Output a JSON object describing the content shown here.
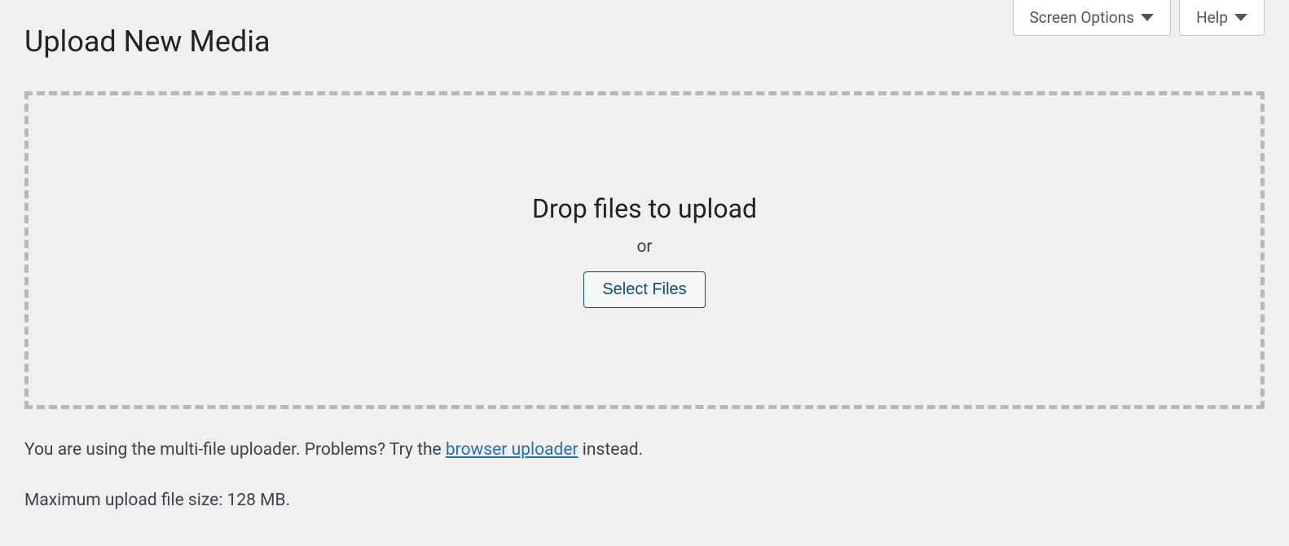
{
  "header": {
    "screen_options_label": "Screen Options",
    "help_label": "Help"
  },
  "page": {
    "title": "Upload New Media"
  },
  "dropzone": {
    "heading": "Drop files to upload",
    "or_label": "or",
    "select_button_label": "Select Files"
  },
  "info": {
    "prefix": "You are using the multi-file uploader. Problems? Try the ",
    "link_text": "browser uploader",
    "suffix": " instead.",
    "max_size": "Maximum upload file size: 128 MB."
  }
}
